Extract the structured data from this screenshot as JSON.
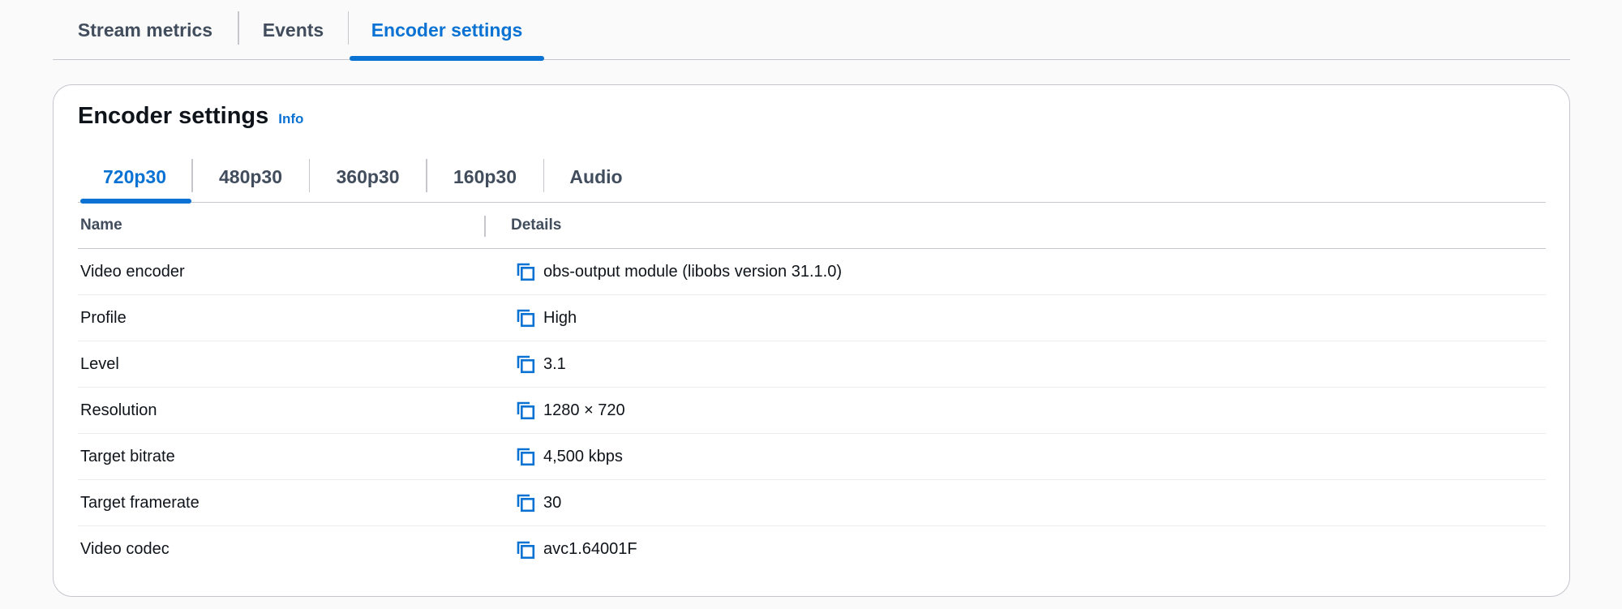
{
  "top_tabs": [
    {
      "label": "Stream metrics",
      "active": false
    },
    {
      "label": "Events",
      "active": false
    },
    {
      "label": "Encoder settings",
      "active": true
    }
  ],
  "panel": {
    "title": "Encoder settings",
    "info_label": "Info"
  },
  "inner_tabs": [
    {
      "label": "720p30",
      "active": true
    },
    {
      "label": "480p30",
      "active": false
    },
    {
      "label": "360p30",
      "active": false
    },
    {
      "label": "160p30",
      "active": false
    },
    {
      "label": "Audio",
      "active": false
    }
  ],
  "table": {
    "columns": [
      "Name",
      "Details"
    ],
    "rows": [
      {
        "name": "Video encoder",
        "value": "obs-output module (libobs version 31.1.0)"
      },
      {
        "name": "Profile",
        "value": "High"
      },
      {
        "name": "Level",
        "value": "3.1"
      },
      {
        "name": "Resolution",
        "value": "1280 × 720"
      },
      {
        "name": "Target bitrate",
        "value": "4,500 kbps"
      },
      {
        "name": "Target framerate",
        "value": "30"
      },
      {
        "name": "Video codec",
        "value": "avc1.64001F"
      }
    ]
  },
  "colors": {
    "accent": "#0972d3",
    "text": "#0f141a",
    "muted": "#414d5c",
    "border": "#c6c6cd"
  },
  "icons": {
    "copy": "copy-icon"
  }
}
